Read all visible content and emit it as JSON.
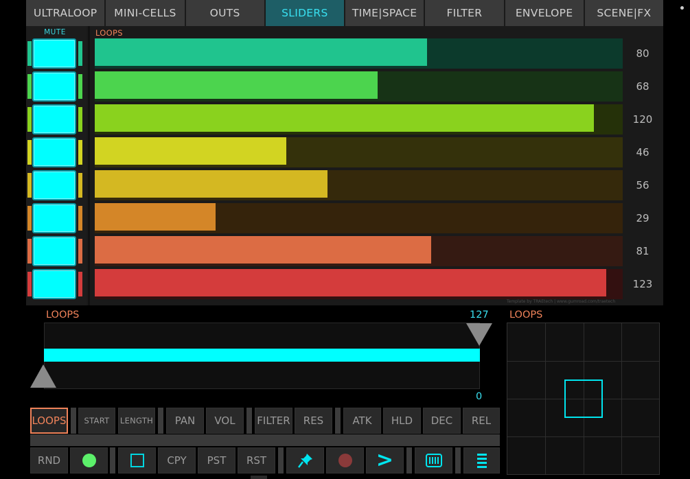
{
  "tabs": [
    {
      "label": "ULTRALOOP",
      "active": false
    },
    {
      "label": "MINI-CELLS",
      "active": false
    },
    {
      "label": "OUTS",
      "active": false
    },
    {
      "label": "SLIDERS",
      "active": true
    },
    {
      "label": "TIME|SPACE",
      "active": false
    },
    {
      "label": "FILTER",
      "active": false
    },
    {
      "label": "ENVELOPE",
      "active": false
    },
    {
      "label": "SCENE|FX",
      "active": false
    }
  ],
  "mute_title": "MUTE",
  "loops_title": "LOOPS",
  "loops": [
    {
      "value": "80",
      "level": 80,
      "fill": "#20c48e",
      "track": "#0c3a2c",
      "strip": "#20c48e"
    },
    {
      "value": "68",
      "level": 68,
      "fill": "#4cd44e",
      "track": "#173316",
      "strip": "#4cd44e"
    },
    {
      "value": "120",
      "level": 120,
      "fill": "#8ad21e",
      "track": "#253109",
      "strip": "#8ad21e"
    },
    {
      "value": "46",
      "level": 46,
      "fill": "#d2d422",
      "track": "#34310b",
      "strip": "#d2d422"
    },
    {
      "value": "56",
      "level": 56,
      "fill": "#d4b822",
      "track": "#35290b",
      "strip": "#d4b822"
    },
    {
      "value": "29",
      "level": 29,
      "fill": "#d48628",
      "track": "#35230b",
      "strip": "#d48628"
    },
    {
      "value": "81",
      "level": 81,
      "fill": "#dc6c44",
      "track": "#351a12",
      "strip": "#dc6c44"
    },
    {
      "value": "123",
      "level": 123,
      "fill": "#d43c3c",
      "track": "#331010",
      "strip": "#d43c3c"
    }
  ],
  "credit": "Template by TRAEtech | www.gumroad.com/traetech",
  "range_slider": {
    "title": "LOOPS",
    "max_label": "127",
    "min_label": "0",
    "low": 0,
    "high": 127
  },
  "xy_pad": {
    "title": "LOOPS"
  },
  "param_buttons": [
    "LOOPS",
    "START",
    "LENGTH",
    "PAN",
    "VOL",
    "FILTER",
    "RES",
    "ATK",
    "HLD",
    "DEC",
    "REL"
  ],
  "bottom_buttons": {
    "rnd": "RND",
    "cpy": "CPY",
    "pst": "PST",
    "rst": "RST",
    "chevron": ">"
  },
  "colors": {
    "accent": "#00ffff",
    "orange": "#f0835a"
  }
}
